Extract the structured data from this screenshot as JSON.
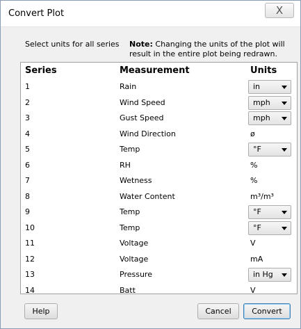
{
  "window": {
    "title": "Convert Plot",
    "close_glyph": "X"
  },
  "instructions": "Select units for all series",
  "note": {
    "label": "Note:",
    "text": " Changing the units of the plot will result in the entire plot being redrawn."
  },
  "table": {
    "headers": {
      "series": "Series",
      "measurement": "Measurement",
      "units": "Units"
    },
    "rows": [
      {
        "series": "1",
        "measurement": "Rain",
        "unit": "in",
        "dropdown": true
      },
      {
        "series": "2",
        "measurement": "Wind Speed",
        "unit": "mph",
        "dropdown": true
      },
      {
        "series": "3",
        "measurement": "Gust Speed",
        "unit": "mph",
        "dropdown": true
      },
      {
        "series": "4",
        "measurement": "Wind Direction",
        "unit": "ø",
        "dropdown": false
      },
      {
        "series": "5",
        "measurement": "Temp",
        "unit": "°F",
        "dropdown": true
      },
      {
        "series": "6",
        "measurement": "RH",
        "unit": "%",
        "dropdown": false
      },
      {
        "series": "7",
        "measurement": "Wetness",
        "unit": "%",
        "dropdown": false
      },
      {
        "series": "8",
        "measurement": "Water Content",
        "unit": "m³/m³",
        "dropdown": false
      },
      {
        "series": "9",
        "measurement": "Temp",
        "unit": "°F",
        "dropdown": true
      },
      {
        "series": "10",
        "measurement": "Temp",
        "unit": "°F",
        "dropdown": true
      },
      {
        "series": "11",
        "measurement": "Voltage",
        "unit": "V",
        "dropdown": false
      },
      {
        "series": "12",
        "measurement": "Voltage",
        "unit": "mA",
        "dropdown": false
      },
      {
        "series": "13",
        "measurement": "Pressure",
        "unit": "in Hg",
        "dropdown": true
      },
      {
        "series": "14",
        "measurement": "Batt",
        "unit": "V",
        "dropdown": false
      }
    ]
  },
  "buttons": {
    "help": "Help",
    "cancel": "Cancel",
    "convert": "Convert"
  }
}
